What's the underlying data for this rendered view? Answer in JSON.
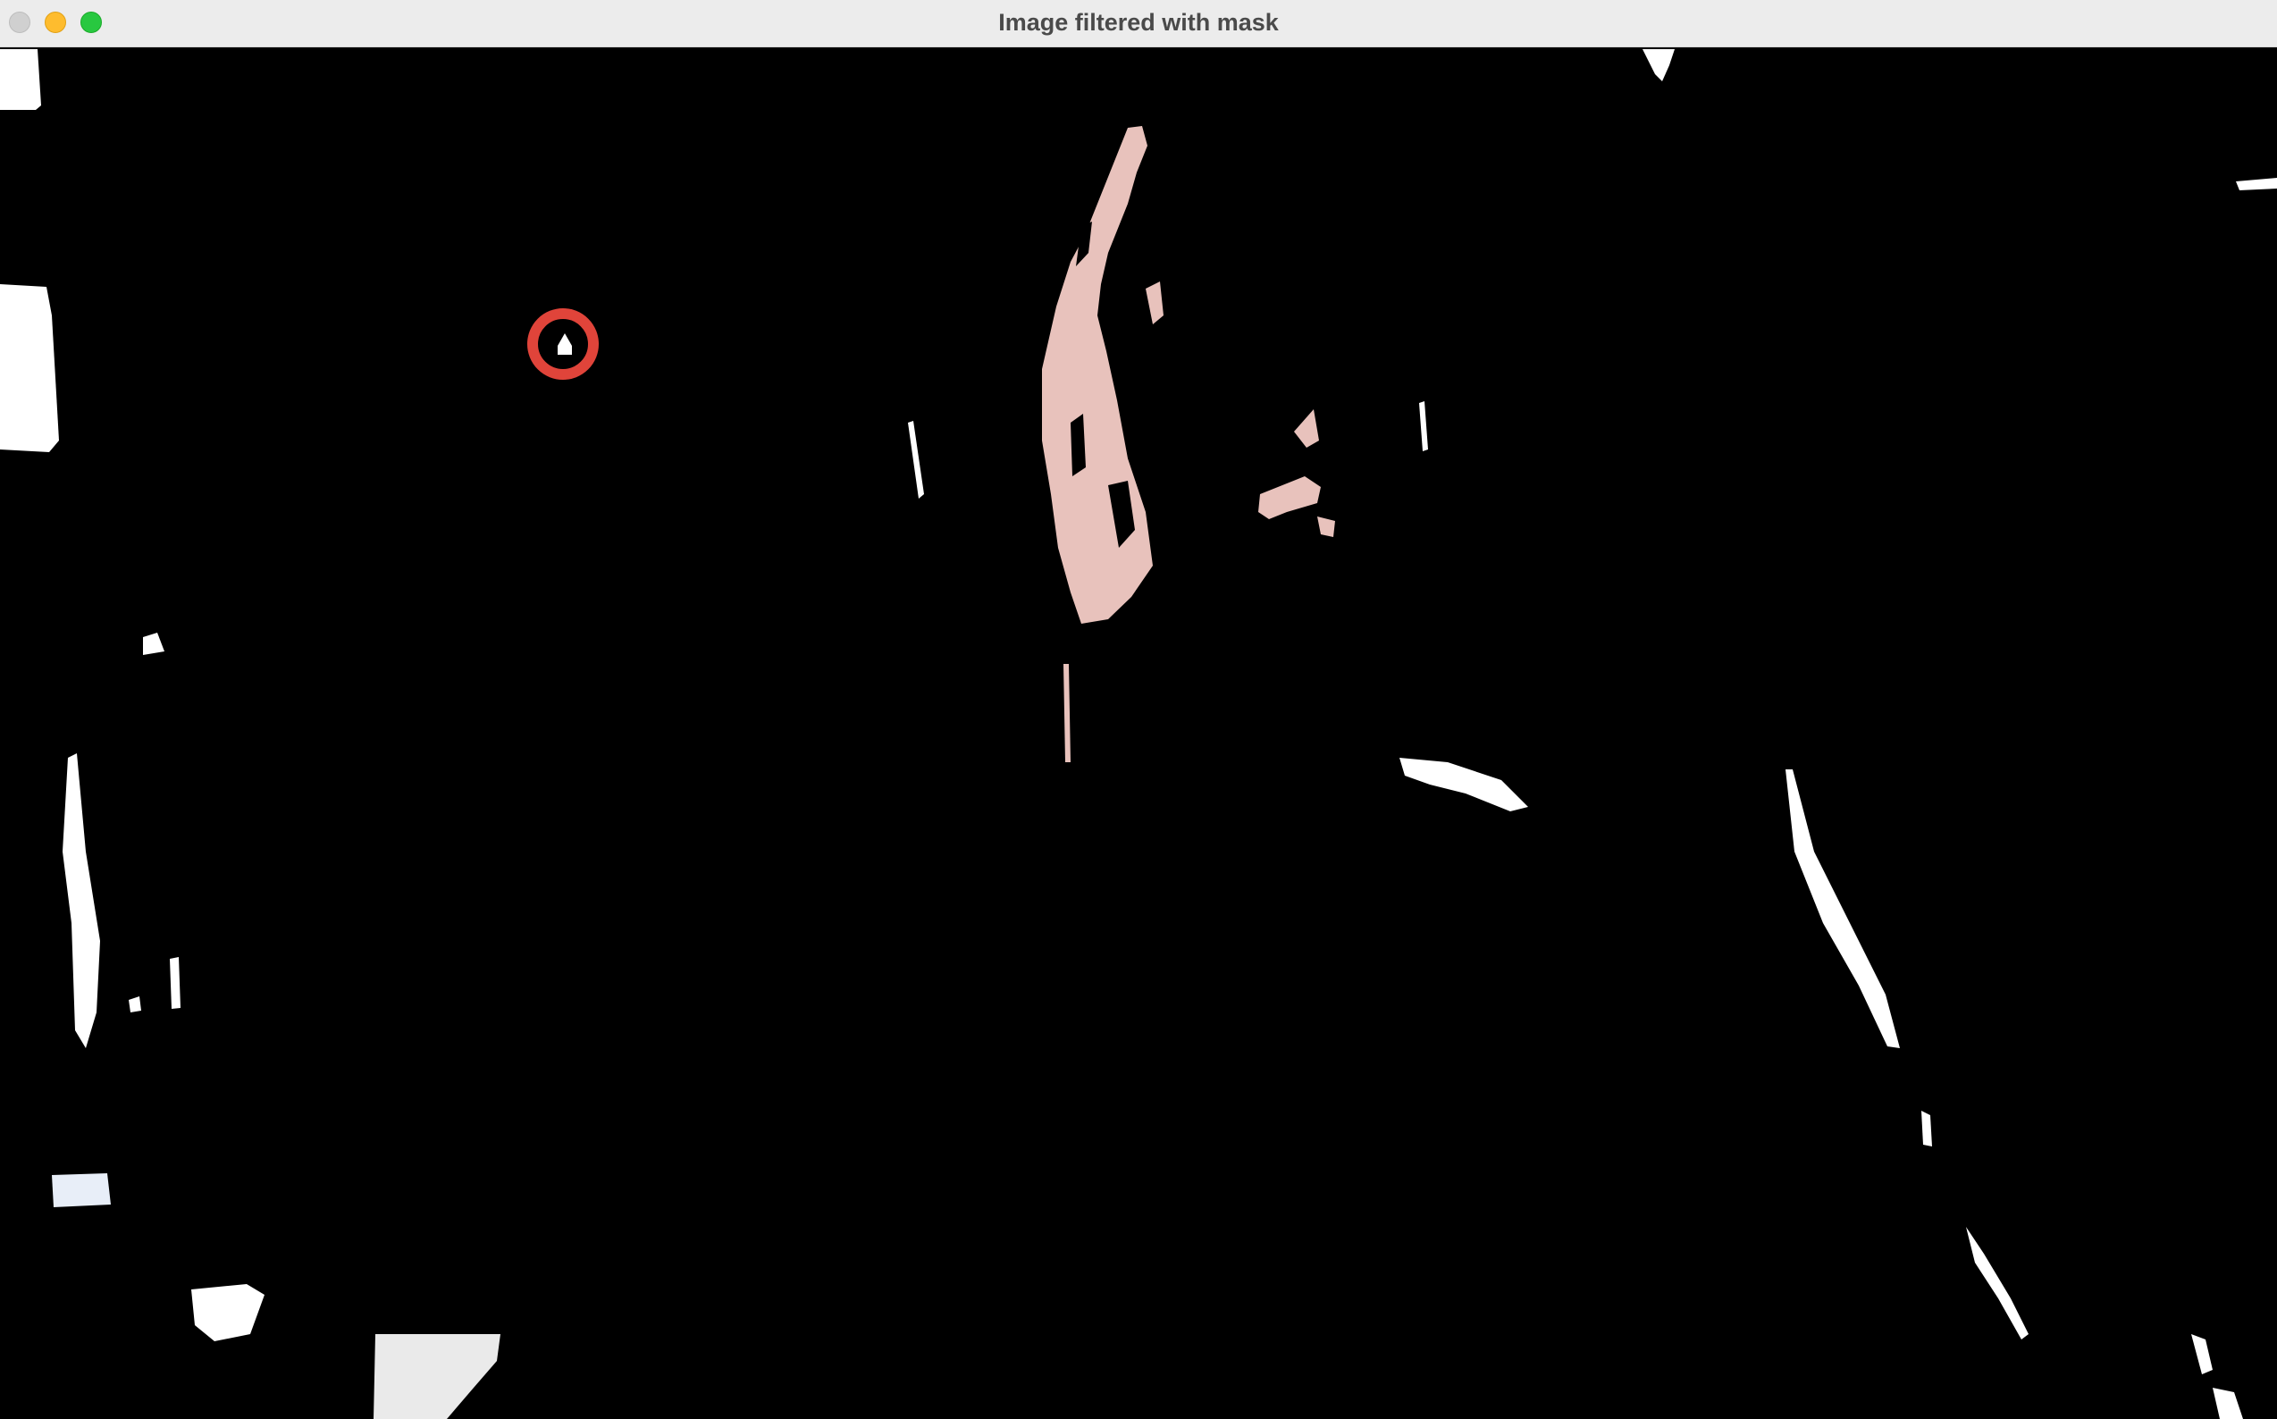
{
  "window": {
    "title": "Image filtered with mask",
    "controls": {
      "close": "close-icon",
      "minimize": "minimize-icon",
      "maximize": "maximize-icon"
    }
  },
  "image": {
    "description_mode": "masked",
    "background_color": "#000000",
    "skin_color": "#e8c2bc",
    "highlight_color": "#ffffff",
    "ring_color": "#e0443a"
  }
}
